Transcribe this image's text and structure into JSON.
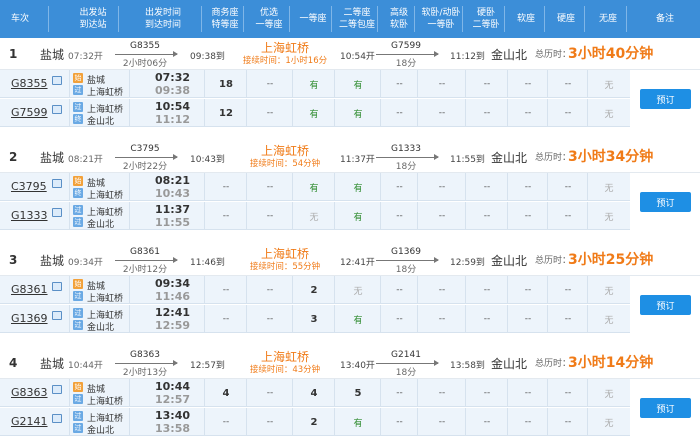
{
  "header": {
    "cols": [
      {
        "l1": "车次",
        "l2": ""
      },
      {
        "l1": "出发站",
        "l2": "到达站"
      },
      {
        "l1": "出发时间",
        "l2": "到达时间"
      },
      {
        "l1": "商务座",
        "l2": "特等座"
      },
      {
        "l1": "优选",
        "l2": "一等座"
      },
      {
        "l1": "一等座",
        "l2": ""
      },
      {
        "l1": "二等座",
        "l2": "二等包座"
      },
      {
        "l1": "高级",
        "l2": "软卧"
      },
      {
        "l1": "软卧/动卧",
        "l2": "一等卧"
      },
      {
        "l1": "硬卧",
        "l2": "二等卧"
      },
      {
        "l1": "软座",
        "l2": ""
      },
      {
        "l1": "硬座",
        "l2": ""
      },
      {
        "l1": "无座",
        "l2": ""
      },
      {
        "l1": "备注",
        "l2": ""
      }
    ]
  },
  "book_label": "预订",
  "groups": [
    {
      "index": "1",
      "from": "盐城",
      "from_time": "07:32开",
      "train1": "G8355",
      "dur1": "2小时06分",
      "arr1": "09:38到",
      "transfer": "上海虹桥",
      "wait": "接续时间：1小时16分",
      "dep2": "10:54开",
      "train2": "G7599",
      "dur2": "18分",
      "arr2": "11:12到",
      "dest": "金山北",
      "total_label": "总历时：",
      "total": "3小时40分钟",
      "legs": [
        {
          "no": "G8355",
          "s1": "盐城",
          "s2": "上海虹桥",
          "b1": "始",
          "b2": "过",
          "t1": "07:32",
          "t2": "09:38",
          "seats": [
            "18",
            "--",
            "有",
            "有",
            "--",
            "--",
            "--",
            "--",
            "--",
            "无"
          ]
        },
        {
          "no": "G7599",
          "s1": "上海虹桥",
          "s2": "金山北",
          "b1": "过",
          "b2": "终",
          "t1": "10:54",
          "t2": "11:12",
          "seats": [
            "12",
            "--",
            "有",
            "有",
            "--",
            "--",
            "--",
            "--",
            "--",
            "无"
          ]
        }
      ]
    },
    {
      "index": "2",
      "from": "盐城",
      "from_time": "08:21开",
      "train1": "C3795",
      "dur1": "2小时22分",
      "arr1": "10:43到",
      "transfer": "上海虹桥",
      "wait": "接续时间：54分钟",
      "dep2": "11:37开",
      "train2": "G1333",
      "dur2": "18分",
      "arr2": "11:55到",
      "dest": "金山北",
      "total_label": "总历时：",
      "total": "3小时34分钟",
      "legs": [
        {
          "no": "C3795",
          "s1": "盐城",
          "s2": "上海虹桥",
          "b1": "始",
          "b2": "终",
          "t1": "08:21",
          "t2": "10:43",
          "seats": [
            "--",
            "--",
            "有",
            "有",
            "--",
            "--",
            "--",
            "--",
            "--",
            "无"
          ]
        },
        {
          "no": "G1333",
          "s1": "上海虹桥",
          "s2": "金山北",
          "b1": "过",
          "b2": "过",
          "t1": "11:37",
          "t2": "11:55",
          "seats": [
            "--",
            "--",
            "无",
            "有",
            "--",
            "--",
            "--",
            "--",
            "--",
            "无"
          ]
        }
      ]
    },
    {
      "index": "3",
      "from": "盐城",
      "from_time": "09:34开",
      "train1": "G8361",
      "dur1": "2小时12分",
      "arr1": "11:46到",
      "transfer": "上海虹桥",
      "wait": "接续时间：55分钟",
      "dep2": "12:41开",
      "train2": "G1369",
      "dur2": "18分",
      "arr2": "12:59到",
      "dest": "金山北",
      "total_label": "总历时：",
      "total": "3小时25分钟",
      "legs": [
        {
          "no": "G8361",
          "s1": "盐城",
          "s2": "上海虹桥",
          "b1": "始",
          "b2": "过",
          "t1": "09:34",
          "t2": "11:46",
          "seats": [
            "--",
            "--",
            "2",
            "无",
            "--",
            "--",
            "--",
            "--",
            "--",
            "无"
          ]
        },
        {
          "no": "G1369",
          "s1": "上海虹桥",
          "s2": "金山北",
          "b1": "过",
          "b2": "过",
          "t1": "12:41",
          "t2": "12:59",
          "seats": [
            "--",
            "--",
            "3",
            "有",
            "--",
            "--",
            "--",
            "--",
            "--",
            "无"
          ]
        }
      ]
    },
    {
      "index": "4",
      "from": "盐城",
      "from_time": "10:44开",
      "train1": "G8363",
      "dur1": "2小时13分",
      "arr1": "12:57到",
      "transfer": "上海虹桥",
      "wait": "接续时间：43分钟",
      "dep2": "13:40开",
      "train2": "G2141",
      "dur2": "18分",
      "arr2": "13:58到",
      "dest": "金山北",
      "total_label": "总历时：",
      "total": "3小时14分钟",
      "legs": [
        {
          "no": "G8363",
          "s1": "盐城",
          "s2": "上海虹桥",
          "b1": "始",
          "b2": "过",
          "t1": "10:44",
          "t2": "12:57",
          "seats": [
            "4",
            "--",
            "4",
            "5",
            "--",
            "--",
            "--",
            "--",
            "--",
            "无"
          ]
        },
        {
          "no": "G2141",
          "s1": "上海虹桥",
          "s2": "金山北",
          "b1": "过",
          "b2": "过",
          "t1": "13:40",
          "t2": "13:58",
          "seats": [
            "--",
            "--",
            "2",
            "有",
            "--",
            "--",
            "--",
            "--",
            "--",
            "无"
          ]
        }
      ]
    }
  ]
}
